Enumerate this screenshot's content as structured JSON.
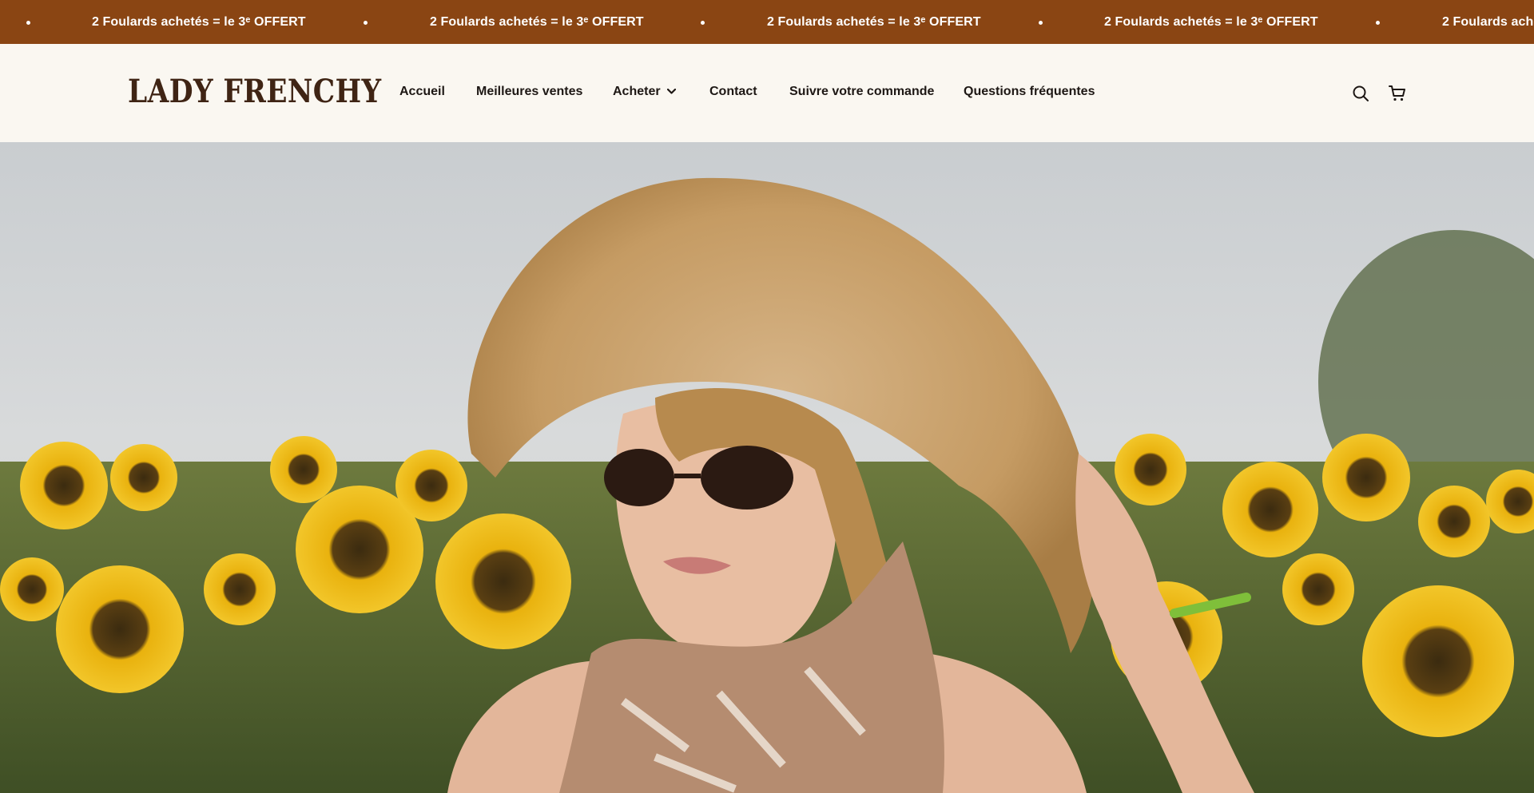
{
  "announcement": {
    "text": "2 Foulards achetés = le 3ᵉ OFFERT",
    "background": "#8a4513"
  },
  "header": {
    "logo": "LADY FRENCHY",
    "nav": [
      {
        "label": "Accueil"
      },
      {
        "label": "Meilleures ventes"
      },
      {
        "label": "Acheter",
        "has_dropdown": true
      },
      {
        "label": "Contact"
      },
      {
        "label": "Suivre votre commande"
      },
      {
        "label": "Questions fréquentes"
      }
    ],
    "icons": [
      "search-icon",
      "cart-icon"
    ]
  },
  "hero": {
    "image": "woman-straw-hat-sunflowers-photo"
  }
}
